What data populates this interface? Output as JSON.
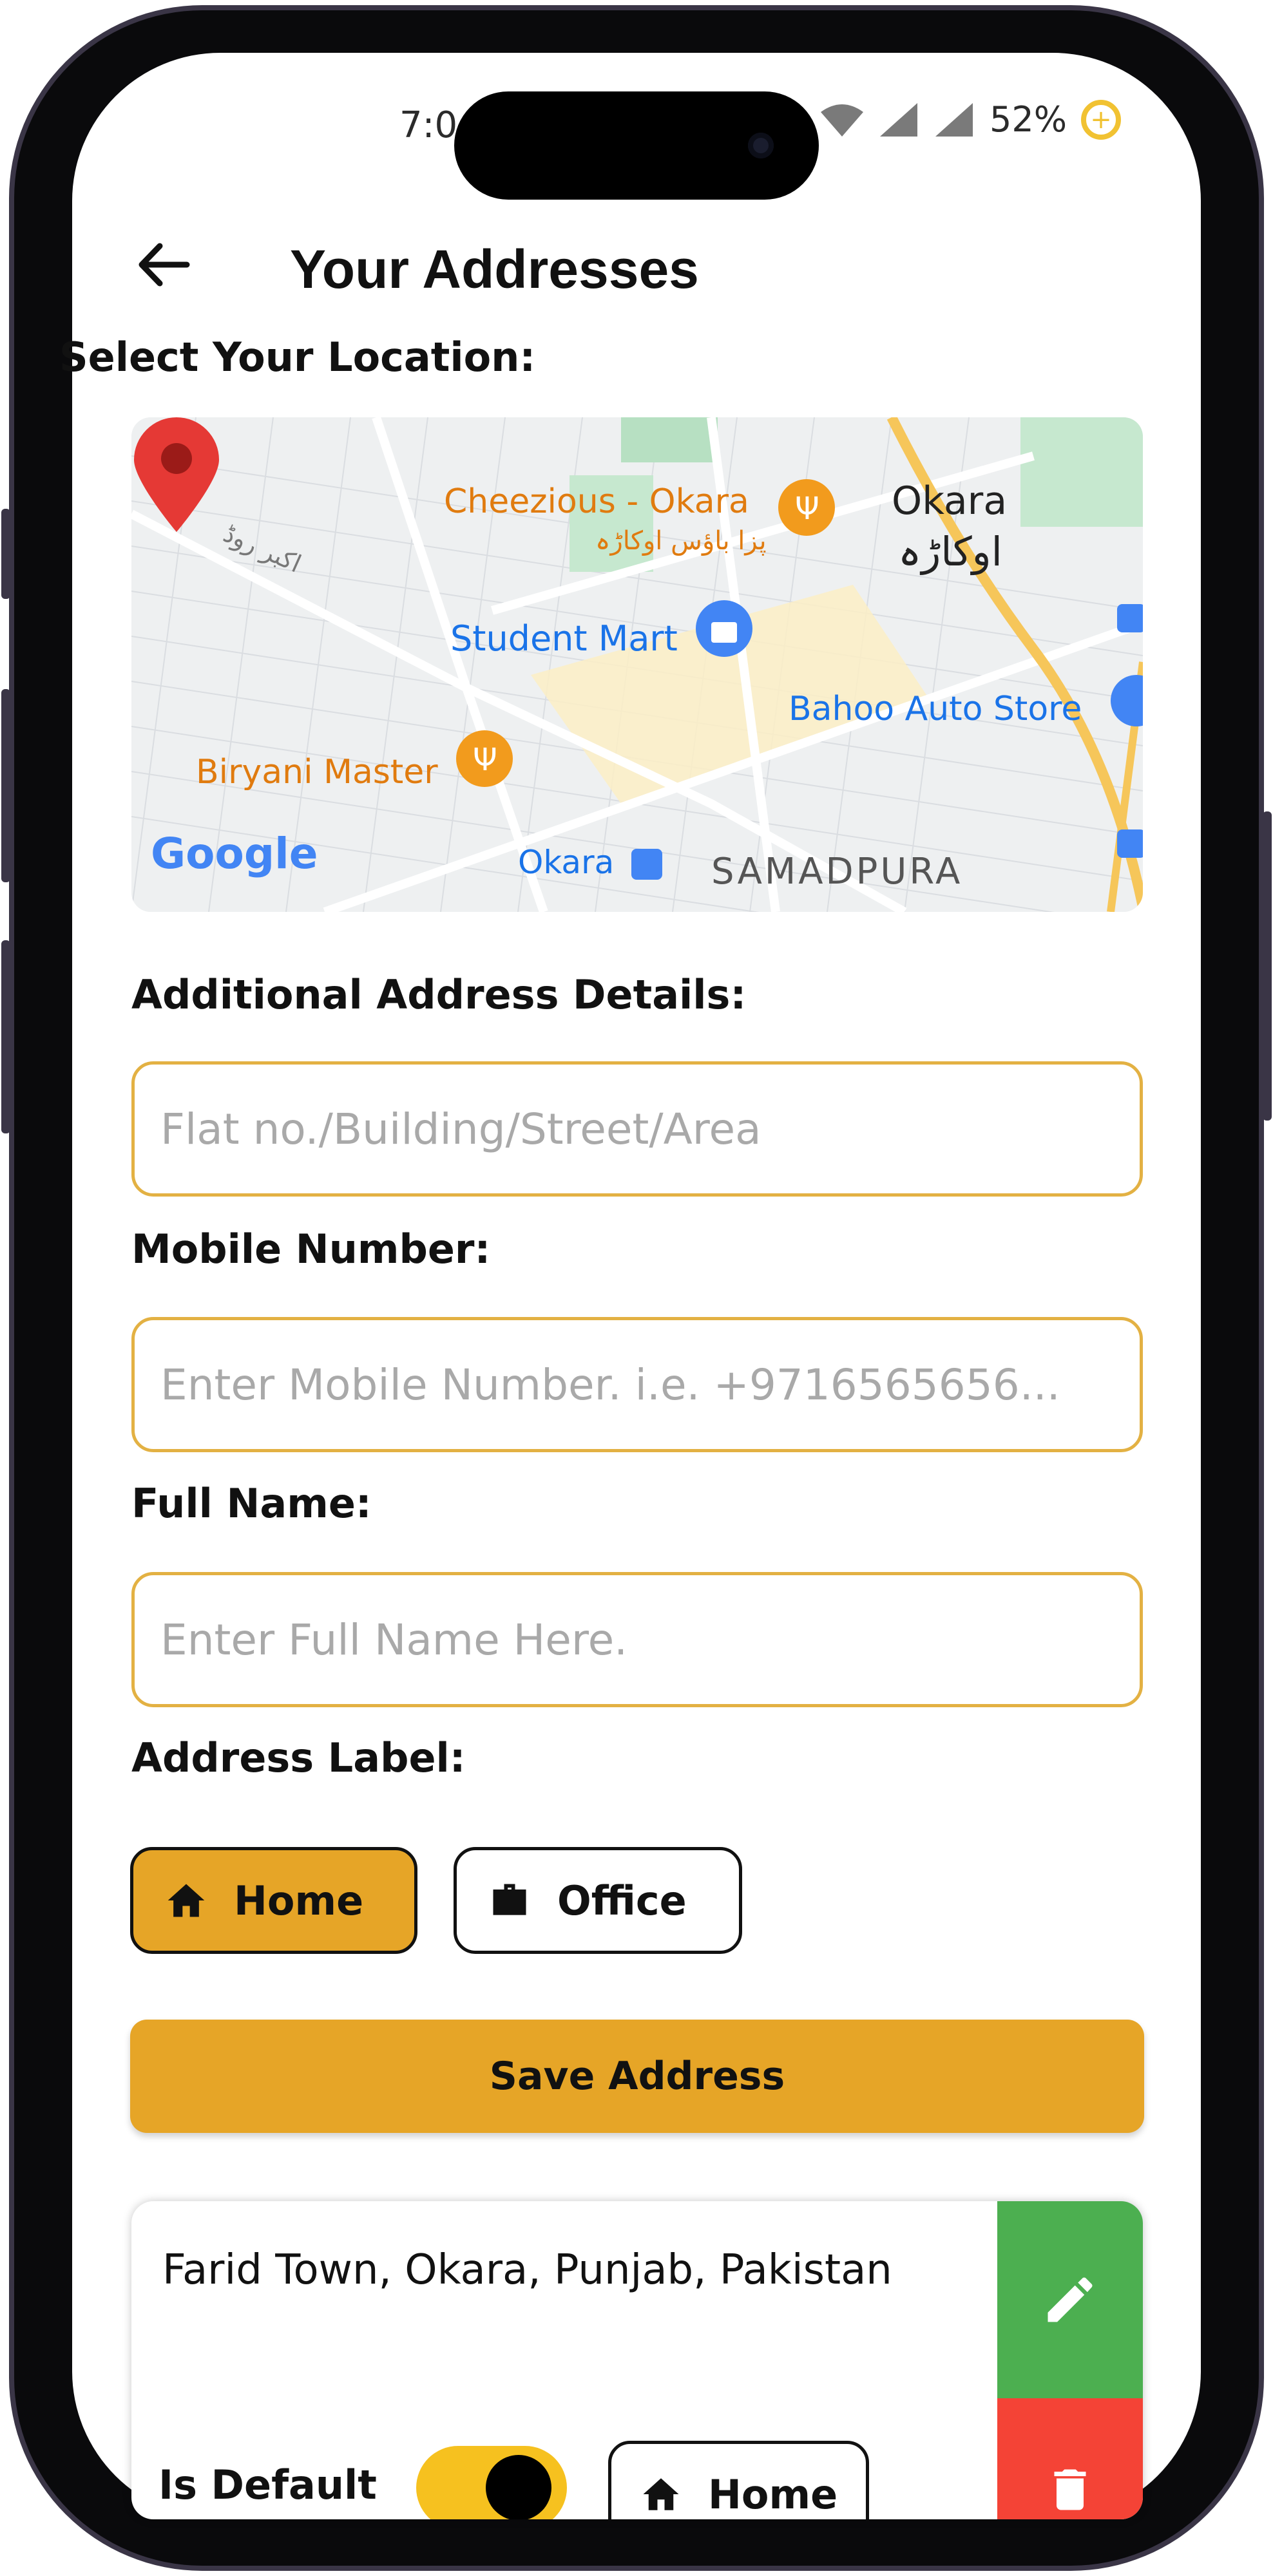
{
  "status_bar": {
    "time": "7:0",
    "battery_percent": "52%"
  },
  "header": {
    "title": "Your Addresses"
  },
  "location_section": {
    "label": "Select Your Location:",
    "map": {
      "labels": {
        "cheezious": "Cheezious - Okara",
        "cheezious_urdu": "پزا باؤس اوکاڑہ",
        "okara": "Okara",
        "okara_urdu": "اوکاڑہ",
        "akbar_road": "اکبر روڈ",
        "student_mart": "Student Mart",
        "bahoo": "Bahoo Auto Store",
        "biryani": "Biryani Master",
        "okara_station": "Okara",
        "samadpura": "SAMADPURA",
        "google": "Google"
      }
    }
  },
  "form": {
    "additional_label": "Additional Address Details:",
    "additional_placeholder": "Flat no./Building/Street/Area",
    "mobile_label": "Mobile Number:",
    "mobile_placeholder": "Enter Mobile Number. i.e. +9716565656...",
    "name_label": "Full Name:",
    "name_placeholder": "Enter Full Name Here.",
    "address_label": "Address Label:",
    "label_options": [
      {
        "label": "Home",
        "selected": true,
        "icon": "home-icon"
      },
      {
        "label": "Office",
        "selected": false,
        "icon": "briefcase-icon"
      }
    ],
    "save_label": "Save Address"
  },
  "saved_address": {
    "address": "Farid Town, Okara, Punjab, Pakistan",
    "default_label": "Is Default",
    "is_default": true,
    "label": "Home"
  },
  "colors": {
    "accent": "#e6a527",
    "input_border": "#e3b143",
    "edit": "#4caf50",
    "delete": "#f44336",
    "toggle": "#f6c11f"
  }
}
